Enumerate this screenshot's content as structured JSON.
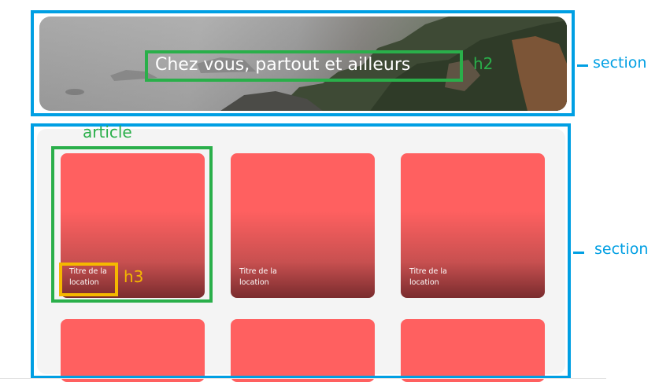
{
  "hero": {
    "title": "Chez vous, partout et ailleurs"
  },
  "annotations": {
    "section_top": "section",
    "section_bottom": "section",
    "h2": "h2",
    "article": "article",
    "h3": "h3"
  },
  "cards": [
    {
      "title": "Titre de la location"
    },
    {
      "title": "Titre de la location"
    },
    {
      "title": "Titre de la location"
    }
  ],
  "colors": {
    "annotation_blue": "#009fe3",
    "annotation_green": "#2aaf4a",
    "annotation_yellow": "#f5b800",
    "card_red": "#ff6060",
    "card_dark": "#7a2c2e",
    "panel_gray": "#f4f4f4"
  }
}
